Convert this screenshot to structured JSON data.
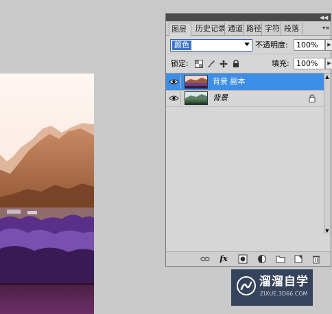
{
  "panel": {
    "tabs": [
      {
        "label": "图层",
        "active": true
      },
      {
        "label": "历史记录",
        "active": false
      },
      {
        "label": "通道",
        "active": false
      },
      {
        "label": "路径",
        "active": false
      },
      {
        "label": "字符",
        "active": false
      },
      {
        "label": "段落",
        "active": false
      }
    ],
    "collapse_icon": "double-chevron-right-icon",
    "blend_mode": "颜色",
    "opacity_label": "不透明度:",
    "opacity_value": "100%",
    "lock_label": "锁定:",
    "fill_label": "填充:",
    "fill_value": "100%",
    "layers": [
      {
        "name": "背景 副本",
        "selected": true,
        "visible": true
      },
      {
        "name": "背景",
        "selected": false,
        "visible": true,
        "locked": true
      }
    ],
    "fx_label": "fx"
  },
  "watermark": {
    "title": "溜溜自学",
    "subtitle": "ZIXUE.3D66.COM"
  },
  "colors": {
    "panel_bg": "#d6d6d6",
    "selection": "#3d8ee6",
    "workspace": "#c9c9c9",
    "watermark_bg": "#36435c"
  }
}
